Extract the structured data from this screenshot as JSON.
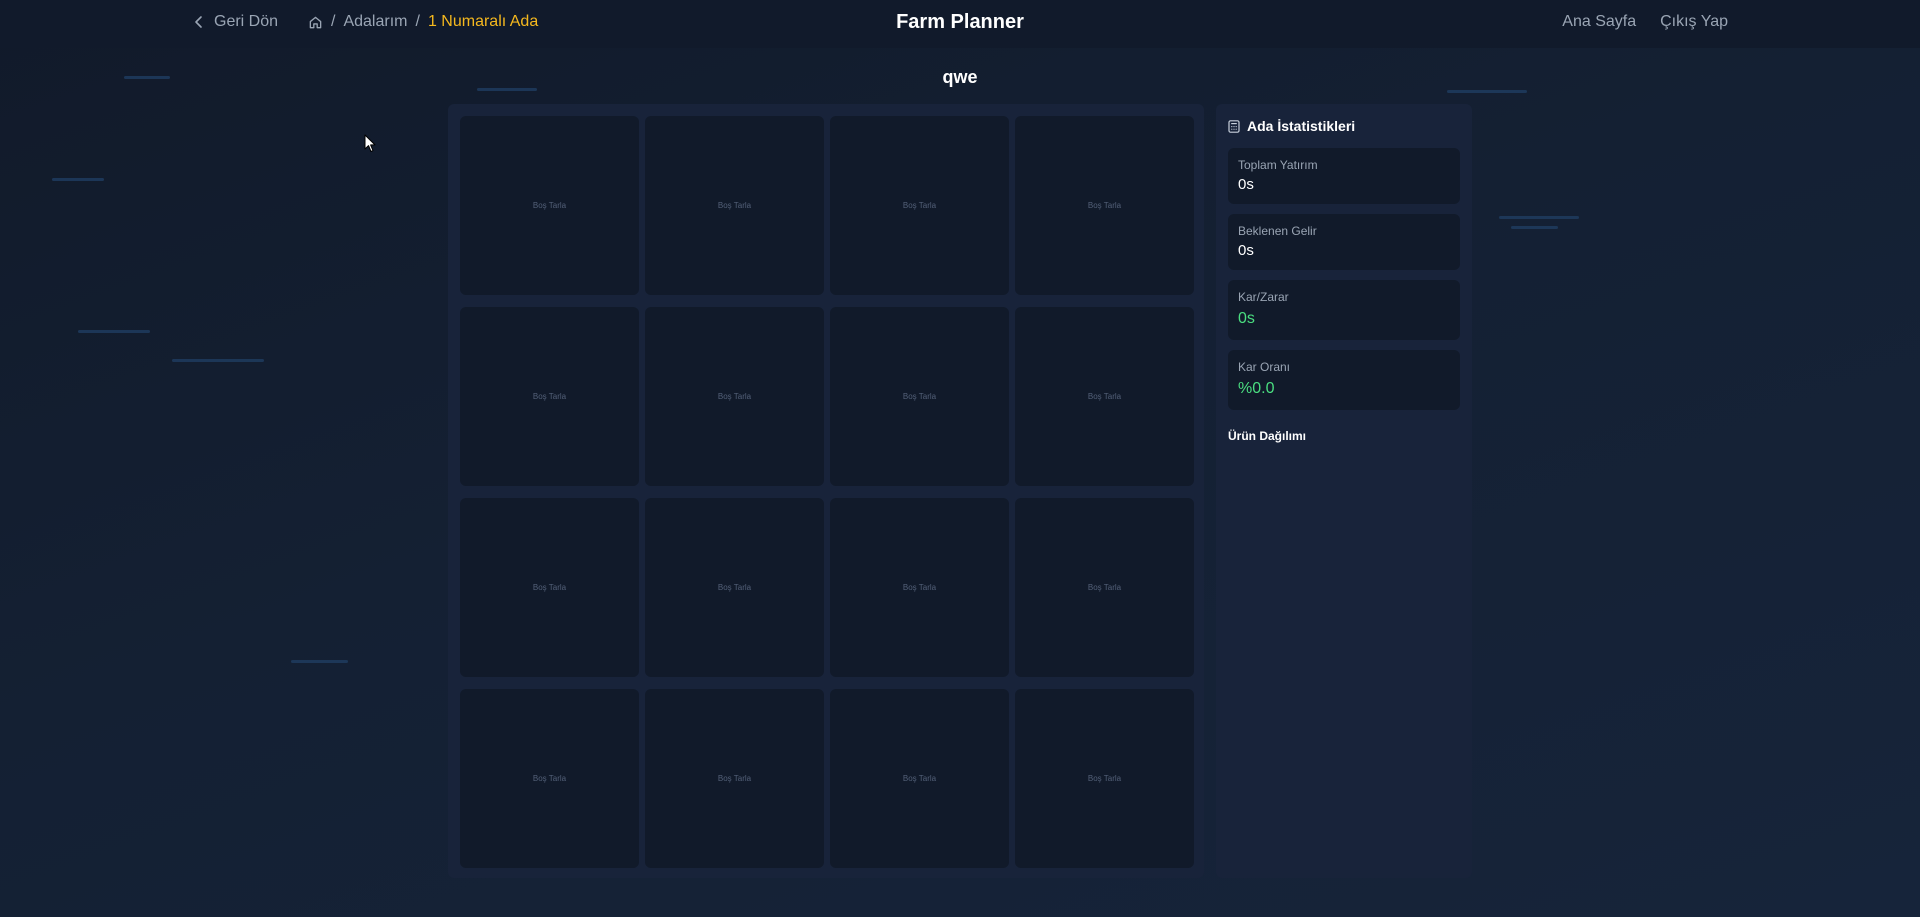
{
  "header": {
    "back_label": "Geri Dön",
    "breadcrumb": {
      "islands": "Adalarım",
      "separator": "/",
      "current": "1 Numaralı Ada"
    },
    "app_title": "Farm Planner",
    "nav": {
      "home": "Ana Sayfa",
      "logout": "Çıkış Yap"
    }
  },
  "island": {
    "name": "qwe"
  },
  "plots": [
    "Boş Tarla",
    "Boş Tarla",
    "Boş Tarla",
    "Boş Tarla",
    "Boş Tarla",
    "Boş Tarla",
    "Boş Tarla",
    "Boş Tarla",
    "Boş Tarla",
    "Boş Tarla",
    "Boş Tarla",
    "Boş Tarla",
    "Boş Tarla",
    "Boş Tarla",
    "Boş Tarla",
    "Boş Tarla"
  ],
  "stats": {
    "title": "Ada İstatistikleri",
    "total_investment": {
      "label": "Toplam Yatırım",
      "value": "0s"
    },
    "expected_income": {
      "label": "Beklenen Gelir",
      "value": "0s"
    },
    "profit_loss": {
      "label": "Kar/Zarar",
      "value": "0s"
    },
    "profit_ratio": {
      "label": "Kar Oranı",
      "value": "%0.0"
    },
    "distribution_title": "Ürün Dağılımı"
  },
  "colors": {
    "accent": "#f5b81e",
    "positive": "#4ade80",
    "background": "#111a2a",
    "panel": "#18233a"
  }
}
